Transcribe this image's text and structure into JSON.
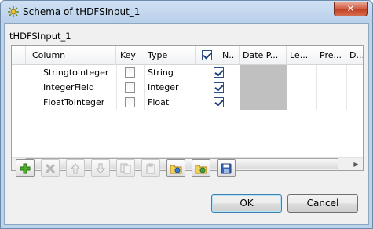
{
  "window": {
    "title": "Schema of tHDFSInput_1",
    "close_glyph": "✕"
  },
  "component_name": "tHDFSInput_1",
  "table": {
    "columns": {
      "column": "Column",
      "key": "Key",
      "type": "Type",
      "nullable": "N..",
      "date_pattern": "Date P...",
      "length": "Le...",
      "precision": "Pre...",
      "default": "D..."
    },
    "header_nullable_checked": true,
    "rows": [
      {
        "name": "StringtoInteger",
        "key": false,
        "type": "String",
        "nullable": true
      },
      {
        "name": "IntegerField",
        "key": false,
        "type": "Integer",
        "nullable": true
      },
      {
        "name": "FloatToInteger",
        "key": false,
        "type": "Float",
        "nullable": true
      }
    ]
  },
  "scrollbar": {
    "left_arrow": "◀",
    "right_arrow": "▶"
  },
  "toolbar": {
    "buttons": [
      {
        "name": "add-icon",
        "enabled": true
      },
      {
        "name": "delete-icon",
        "enabled": false
      },
      {
        "name": "move-up-icon",
        "enabled": false
      },
      {
        "name": "move-down-icon",
        "enabled": false
      },
      {
        "name": "copy-icon",
        "enabled": false
      },
      {
        "name": "paste-icon",
        "enabled": false
      },
      {
        "name": "import-icon",
        "enabled": true
      },
      {
        "name": "export-icon",
        "enabled": true
      },
      {
        "name": "save-icon",
        "enabled": true
      }
    ]
  },
  "buttons": {
    "ok": "OK",
    "cancel": "Cancel"
  },
  "colors": {
    "accent_green": "#3f9a2c",
    "title_bar": "#bcd3ec",
    "close_red": "#c13f22"
  }
}
